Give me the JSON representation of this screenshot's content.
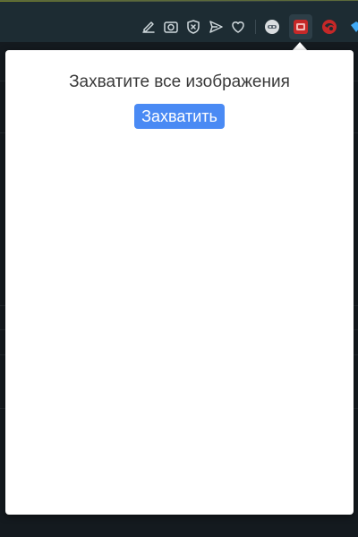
{
  "popup": {
    "title": "Захватите все изображения",
    "capture_label": "Захватить"
  },
  "toolbar": {
    "icons": [
      "edit-icon",
      "camera-icon",
      "shield-x-icon",
      "send-icon",
      "heart-icon"
    ],
    "extensions": [
      "ghost-extension-icon",
      "capture-images-extension-icon",
      "red-swirl-extension-icon",
      "blue-extension-icon"
    ]
  },
  "colors": {
    "button": "#4a8af4",
    "toolbar_bg": "#1d2c33",
    "popup_bg": "#ffffff"
  }
}
